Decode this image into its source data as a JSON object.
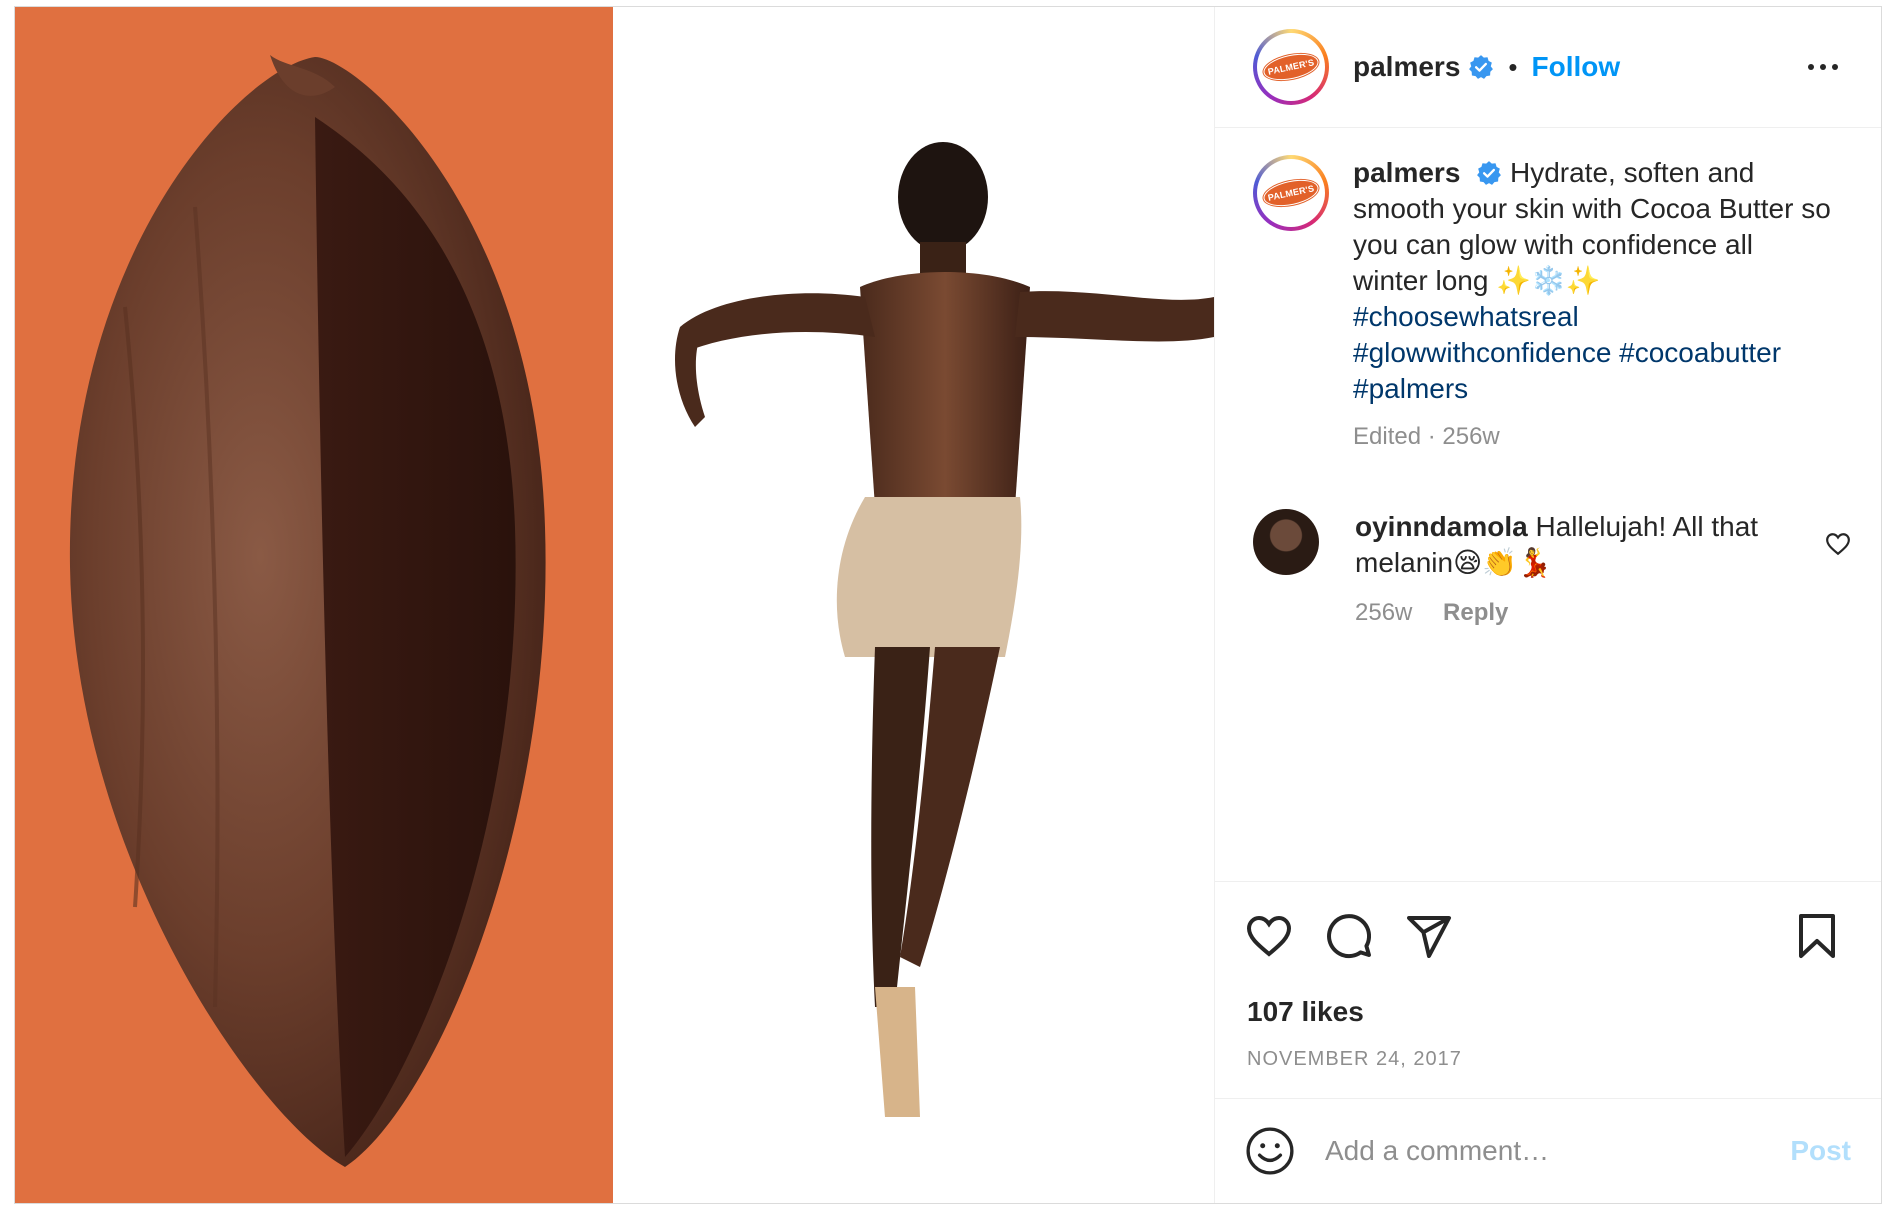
{
  "post": {
    "author": "palmers",
    "follow_label": "Follow",
    "separator": "•",
    "avatar_logo_text": "PALMER'S",
    "caption": {
      "username": "palmers",
      "text": "Hydrate, soften and smooth your skin with Cocoa Butter so you can glow with confidence all winter long ✨❄️✨",
      "hashtags": [
        "#choosewhatsreal",
        "#glowwithconfidence #cocoabutter",
        "#palmers"
      ],
      "meta": "Edited · 256w"
    },
    "comments": [
      {
        "username": "oyinndamola",
        "text": "Hallelujah! All that melanin😪👏💃",
        "age": "256w",
        "reply_label": "Reply"
      }
    ],
    "likes": "107 likes",
    "date": "NOVEMBER 24, 2017",
    "comment_placeholder": "Add a comment…",
    "post_label": "Post"
  },
  "icons": {
    "more": "more-horizontal-icon",
    "like": "heart-icon",
    "comment": "comment-bubble-icon",
    "share": "paper-plane-icon",
    "save": "bookmark-icon",
    "emoji": "emoji-smile-icon",
    "verified": "verified-badge-icon"
  },
  "colors": {
    "accent": "#0095f6",
    "hashtag": "#00376b",
    "muted": "#8e8e8e",
    "media_orange": "#e07040",
    "pod_brown": "#6a3d2a"
  }
}
